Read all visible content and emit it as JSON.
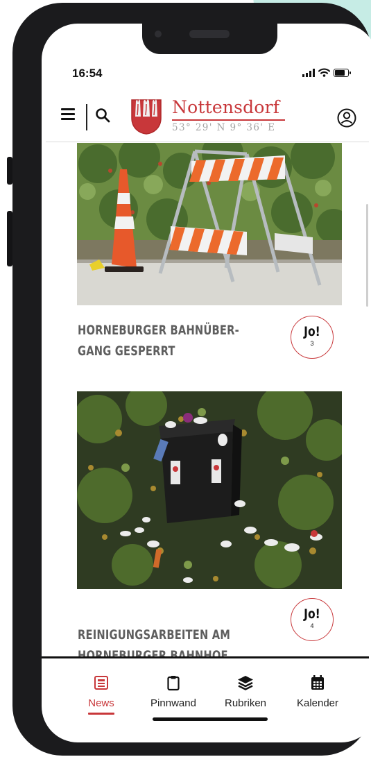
{
  "status_bar": {
    "time": "16:54"
  },
  "header": {
    "logo_name": "Nottensdorf",
    "logo_coords": "53° 29' N  9° 36' E"
  },
  "articles": [
    {
      "title_line1": "HORNEBURGER BAHNÜBER-",
      "title_line2": "GANG GESPERRT",
      "jo_label": "Jo!",
      "jo_count": "3"
    },
    {
      "title_line1": "REINIGUNGSARBEITEN AM",
      "title_line2": "HORNEBURGER BAHNHOF",
      "jo_label": "Jo!",
      "jo_count": "4"
    }
  ],
  "bottom_nav": {
    "items": [
      {
        "label": "News",
        "icon": "newspaper-icon",
        "active": true
      },
      {
        "label": "Pinnwand",
        "icon": "clipboard-icon",
        "active": false
      },
      {
        "label": "Rubriken",
        "icon": "layers-icon",
        "active": false
      },
      {
        "label": "Kalender",
        "icon": "calendar-icon",
        "active": false
      }
    ]
  },
  "colors": {
    "accent": "#c8373a",
    "title_gray": "#5e5e5e",
    "frame": "#1b1b1d"
  }
}
